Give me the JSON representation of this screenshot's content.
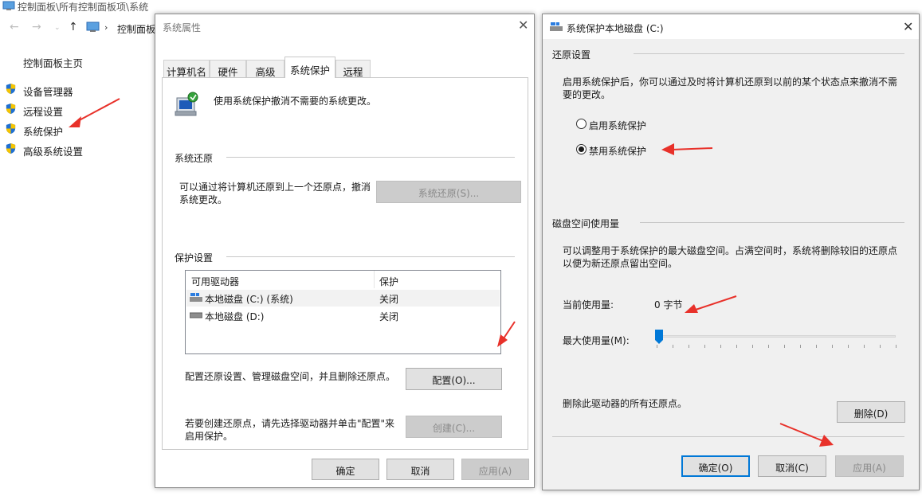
{
  "background": {
    "title": "控制面板\\所有控制面板项\\系统",
    "breadcrumb": "控制面板",
    "home_link": "控制面板主页",
    "links": [
      "设备管理器",
      "远程设置",
      "系统保护",
      "高级系统设置"
    ]
  },
  "sysprops": {
    "title": "系统属性",
    "tabs": [
      "计算机名",
      "硬件",
      "高级",
      "系统保护",
      "远程"
    ],
    "active_tab": "系统保护",
    "intro": "使用系统保护撤消不需要的系统更改。",
    "restore_group": "系统还原",
    "restore_text_1": "可以通过将计算机还原到上一个还原点，撤消",
    "restore_text_2": "系统更改。",
    "restore_button": "系统还原(S)...",
    "protect_group": "保护设置",
    "table": {
      "headers": [
        "可用驱动器",
        "保护"
      ],
      "rows": [
        {
          "drive": "本地磁盘 (C:) (系统)",
          "status": "关闭"
        },
        {
          "drive": "本地磁盘 (D:)",
          "status": "关闭"
        }
      ]
    },
    "config_text": "配置还原设置、管理磁盘空间，并且删除还原点。",
    "config_button": "配置(O)...",
    "create_text_1": "若要创建还原点，请先选择驱动器并单击\"配置\"来",
    "create_text_2": "启用保护。",
    "create_button": "创建(C)...",
    "ok": "确定",
    "cancel": "取消",
    "apply": "应用(A)"
  },
  "diskdlg": {
    "title": "系统保护本地磁盘 (C:)",
    "restore_group": "还原设置",
    "restore_desc_1": "启用系统保护后，你可以通过及时将计算机还原到以前的某个状态点来撤消不需",
    "restore_desc_2": "要的更改。",
    "radio_enable": "启用系统保护",
    "radio_disable": "禁用系统保护",
    "selected": "禁用系统保护",
    "disk_group": "磁盘空间使用量",
    "disk_desc_1": "可以调整用于系统保护的最大磁盘空间。占满空间时，系统将删除较旧的还原点",
    "disk_desc_2": "以便为新还原点留出空间。",
    "current_label": "当前使用量:",
    "current_value": "0 字节",
    "max_label": "最大使用量(M):",
    "max_slider_fraction": 0.0,
    "delete_text": "删除此驱动器的所有还原点。",
    "delete_button": "删除(D)",
    "ok": "确定(O)",
    "cancel": "取消(C)",
    "apply": "应用(A)"
  },
  "colors": {
    "accent": "#0078d7",
    "arrow": "#e8312a",
    "dialog_bg": "#f0f0f0"
  }
}
